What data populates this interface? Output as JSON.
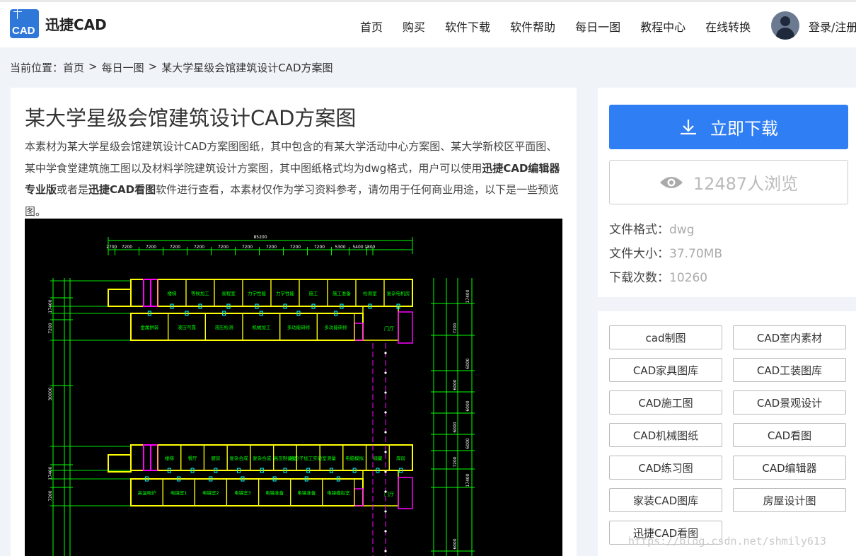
{
  "header": {
    "logo_text": "迅捷CAD",
    "logo_mark": "CAD",
    "nav": [
      "首页",
      "购买",
      "软件下载",
      "软件帮助",
      "每日一图",
      "教程中心",
      "在线转换"
    ],
    "login": "登录/注册"
  },
  "breadcrumb": {
    "label": "当前位置：",
    "items": [
      "首页",
      "每日一图",
      "某大学星级会馆建筑设计CAD方案图"
    ],
    "separator": ">"
  },
  "article": {
    "title": "某大学星级会馆建筑设计CAD方案图",
    "desc_part1": "本素材为某大学星级会馆建筑设计CAD方案图图纸，其中包含的有某大学活动中心方案图、某大学新校区平面图、某中学食堂建筑施工图以及材料学院建筑设计方案图，其中图纸格式均为dwg格式，用户可以使用",
    "desc_bold1": "迅捷CAD编辑器专业版",
    "desc_part2": "或者是",
    "desc_bold2": "迅捷CAD看图",
    "desc_part3": "软件进行查看，本素材仅作为学习资料参考，请勿用于任何商业用途，以下是一些预览图。"
  },
  "cad_drawing": {
    "overall_dim": "85200",
    "top_dims": [
      "2700",
      "7200",
      "7200",
      "7200",
      "7200",
      "7200",
      "7200",
      "7200",
      "7200",
      "7200",
      "5300",
      "5400",
      "1800"
    ],
    "left_dims": [
      "17400",
      "7200",
      "30000",
      "17400",
      "7200"
    ],
    "right_dims": [
      "17400",
      "7200",
      "6000",
      "6000",
      "6000",
      "6000",
      "6000",
      "7200",
      "17400",
      "6000"
    ],
    "upper_north_rooms": [
      "楼梯",
      "等候加工",
      "高程室",
      "力学性能",
      "力学性能",
      "施工",
      "施工准备",
      "检测室",
      "复杂电机房"
    ],
    "upper_south_rooms": [
      "金属拼装",
      "液压可靠",
      "液压检测",
      "机械加工",
      "多功能研修",
      "多功能研修"
    ],
    "lower_north_rooms": [
      "楼梯",
      "餐厅",
      "厨房",
      "复杂合成",
      "复杂合成",
      "高压制备室",
      "高分子加工实验室",
      "测量",
      "电脑模拟",
      "储藏",
      "库房"
    ],
    "lower_south_rooms": [
      "高温电炉",
      "电镜室1",
      "电镜室2",
      "电镜室3",
      "电镜准备",
      "电镜准备",
      "电镜模拟室"
    ],
    "door_labels": [
      "门厅",
      "门厅"
    ]
  },
  "side": {
    "download_label": "立即下载",
    "views_label": "12487人浏览",
    "format_label": "文件格式：",
    "format_value": "dwg",
    "size_label": "文件大小：",
    "size_value": "37.70MB",
    "count_label": "下载次数：",
    "count_value": "10260"
  },
  "tags": [
    "cad制图",
    "CAD室内素材",
    "CAD家具图库",
    "CAD工装图库",
    "CAD施工图",
    "CAD景观设计",
    "CAD机械图纸",
    "CAD看图",
    "CAD练习图",
    "CAD编辑器",
    "家装CAD图库",
    "房屋设计图",
    "迅捷CAD看图"
  ],
  "watermark": "https://blog.csdn.net/shmily613",
  "colors": {
    "accent": "#2f7ef4",
    "page_bg": "#f0f4f9",
    "cad_bg": "#000000",
    "cad_wall": "#ffff00",
    "cad_text": "#00ff00",
    "cad_special": "#ff00ff",
    "cad_door": "#00ffff"
  }
}
